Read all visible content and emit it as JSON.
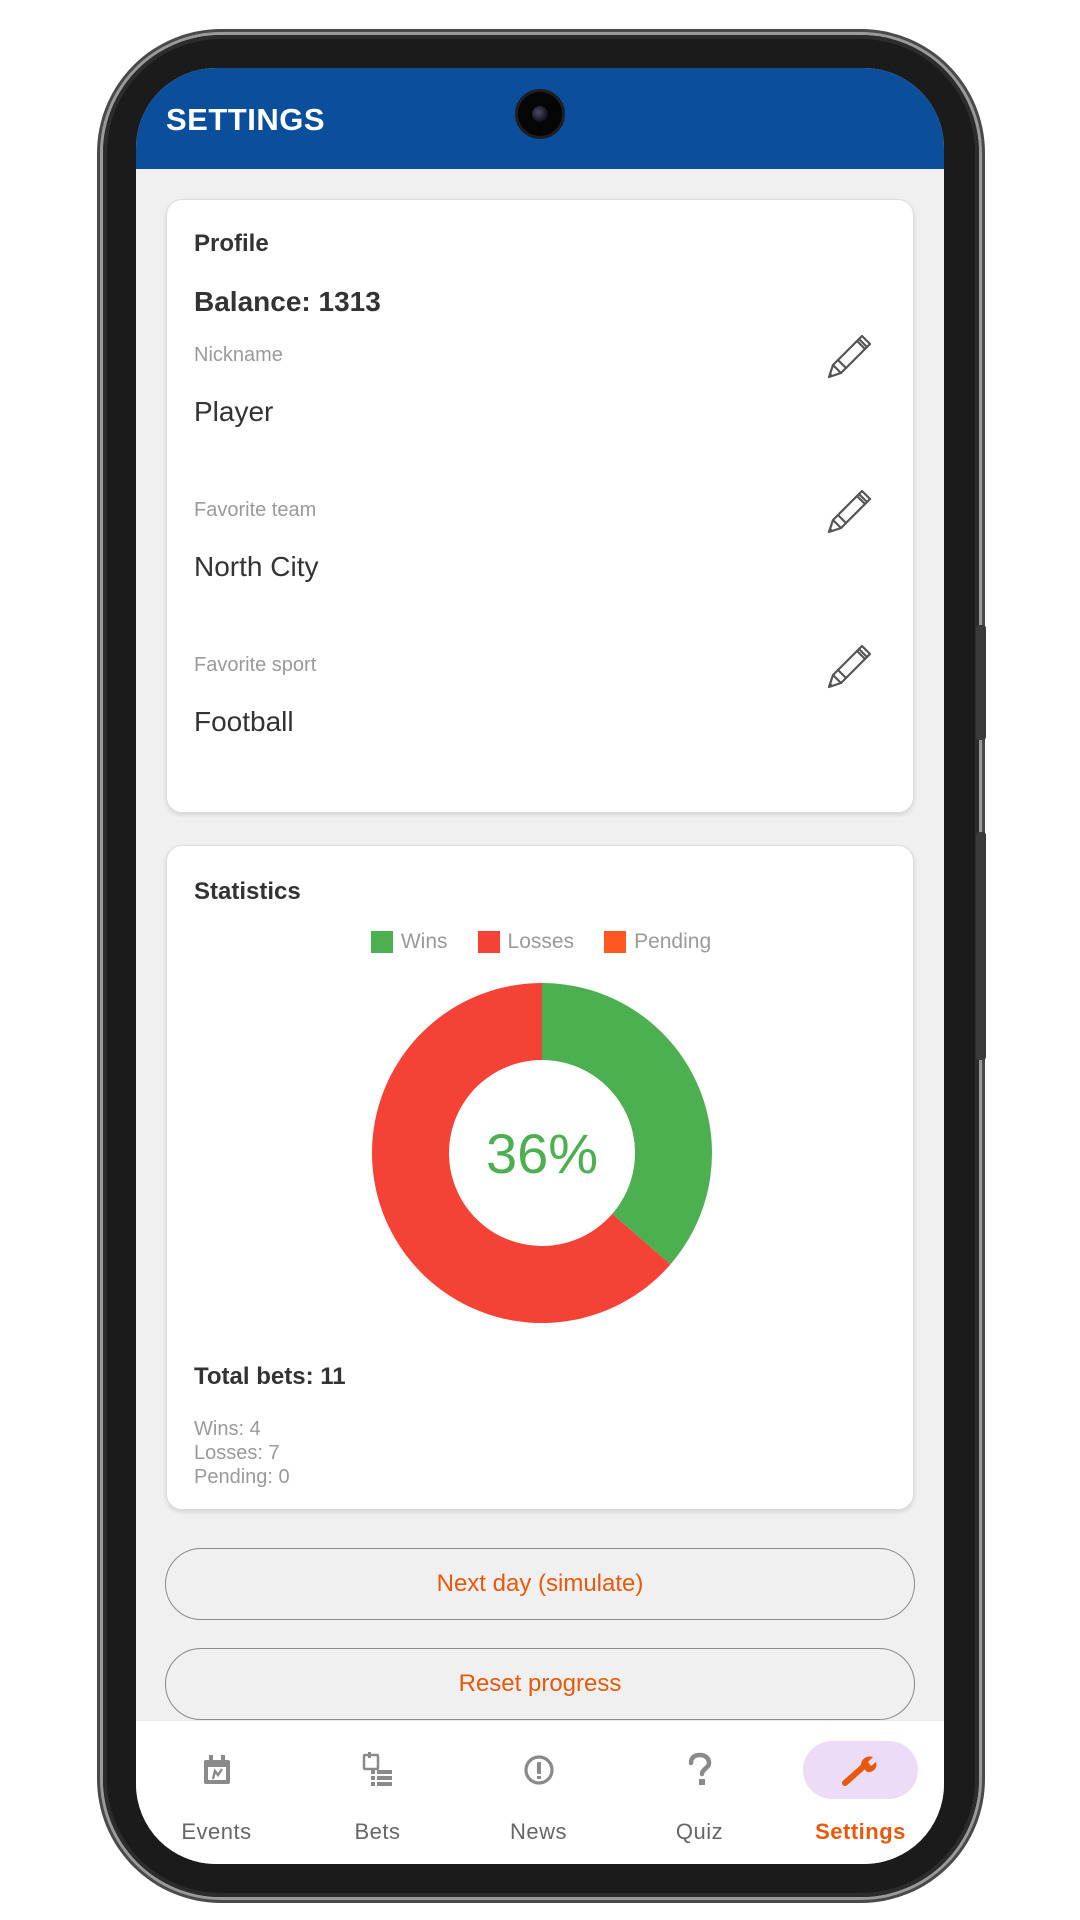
{
  "app_bar": {
    "title": "SETTINGS"
  },
  "profile": {
    "title": "Profile",
    "balance": "Balance: 1313",
    "fields": [
      {
        "label": "Nickname",
        "value": "Player",
        "edit_icon": "pencil-icon"
      },
      {
        "label": "Favorite team",
        "value": "North City",
        "edit_icon": "pencil-icon"
      },
      {
        "label": "Favorite sport",
        "value": "Football",
        "edit_icon": "pencil-icon"
      }
    ]
  },
  "statistics": {
    "title": "Statistics",
    "center_label": "36%",
    "total": "Total bets: 11",
    "lines": [
      "Wins: 4",
      "Losses: 7",
      "Pending: 0"
    ]
  },
  "chart_data": {
    "type": "pie",
    "categories": [
      "Wins",
      "Losses",
      "Pending"
    ],
    "values": [
      4,
      7,
      0
    ],
    "colors": [
      "#4caf50",
      "#f44336",
      "#ff5722"
    ],
    "legend": "top",
    "donut": true
  },
  "actions": {
    "next_day": "Next day (simulate)",
    "reset": "Reset progress"
  },
  "bottom_nav": [
    {
      "label": "Events",
      "icon": "calendar-icon",
      "active": false
    },
    {
      "label": "Bets",
      "icon": "bet-slip-icon",
      "active": false
    },
    {
      "label": "News",
      "icon": "info-icon",
      "active": false
    },
    {
      "label": "Quiz",
      "icon": "question-icon",
      "active": false
    },
    {
      "label": "Settings",
      "icon": "wrench-icon",
      "active": true
    }
  ],
  "colors": {
    "app_bar": "#0b4f9c",
    "accent": "#e8590c",
    "wins": "#4caf50",
    "losses": "#f44336",
    "pending": "#ff5722"
  }
}
